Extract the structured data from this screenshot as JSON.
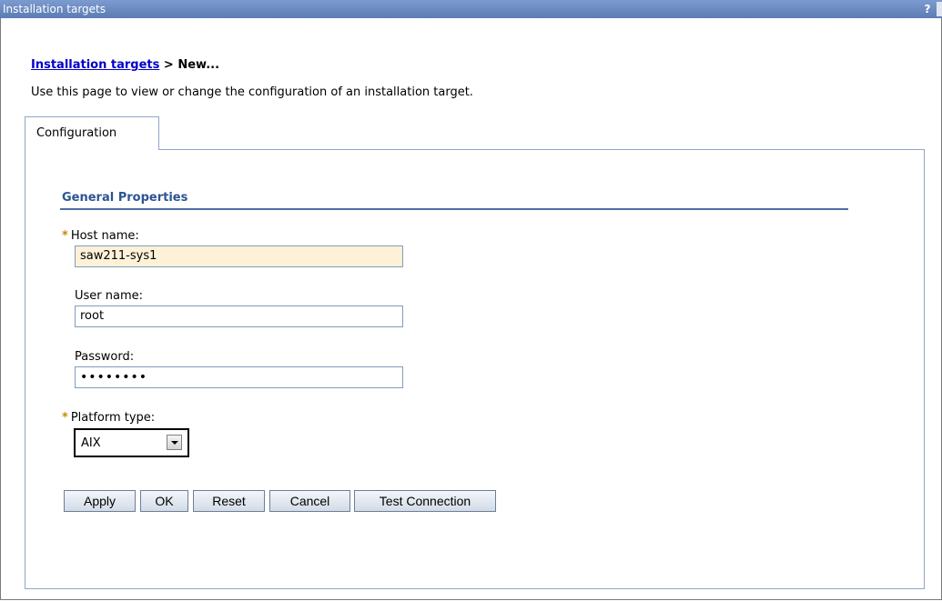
{
  "window": {
    "title": "Installation targets",
    "help_label": "?"
  },
  "breadcrumb": {
    "link": "Installation targets",
    "separator": " > ",
    "current": "New..."
  },
  "description": "Use this page to view or change the configuration of an installation target.",
  "tabs": [
    {
      "label": "Configuration",
      "selected": true
    }
  ],
  "general_properties": {
    "title": "General Properties",
    "required_marker": "*",
    "host_name": {
      "label": "Host name:",
      "value": "saw211-sys1",
      "required": true
    },
    "user_name": {
      "label": "User name:",
      "value": "root",
      "required": false
    },
    "password": {
      "label": "Password:",
      "masked_value": "••••••••",
      "required": false
    },
    "platform_type": {
      "label": "Platform type:",
      "selected": "AIX",
      "required": true
    }
  },
  "buttons": {
    "apply": "Apply",
    "ok": "OK",
    "reset": "Reset",
    "cancel": "Cancel",
    "test_connection": "Test Connection"
  },
  "colors": {
    "titlebar": "#5b7cb4",
    "link": "#0000cc",
    "section_title": "#2c5494",
    "required_marker": "#c88a00",
    "focused_field": "#fdf1d8"
  }
}
